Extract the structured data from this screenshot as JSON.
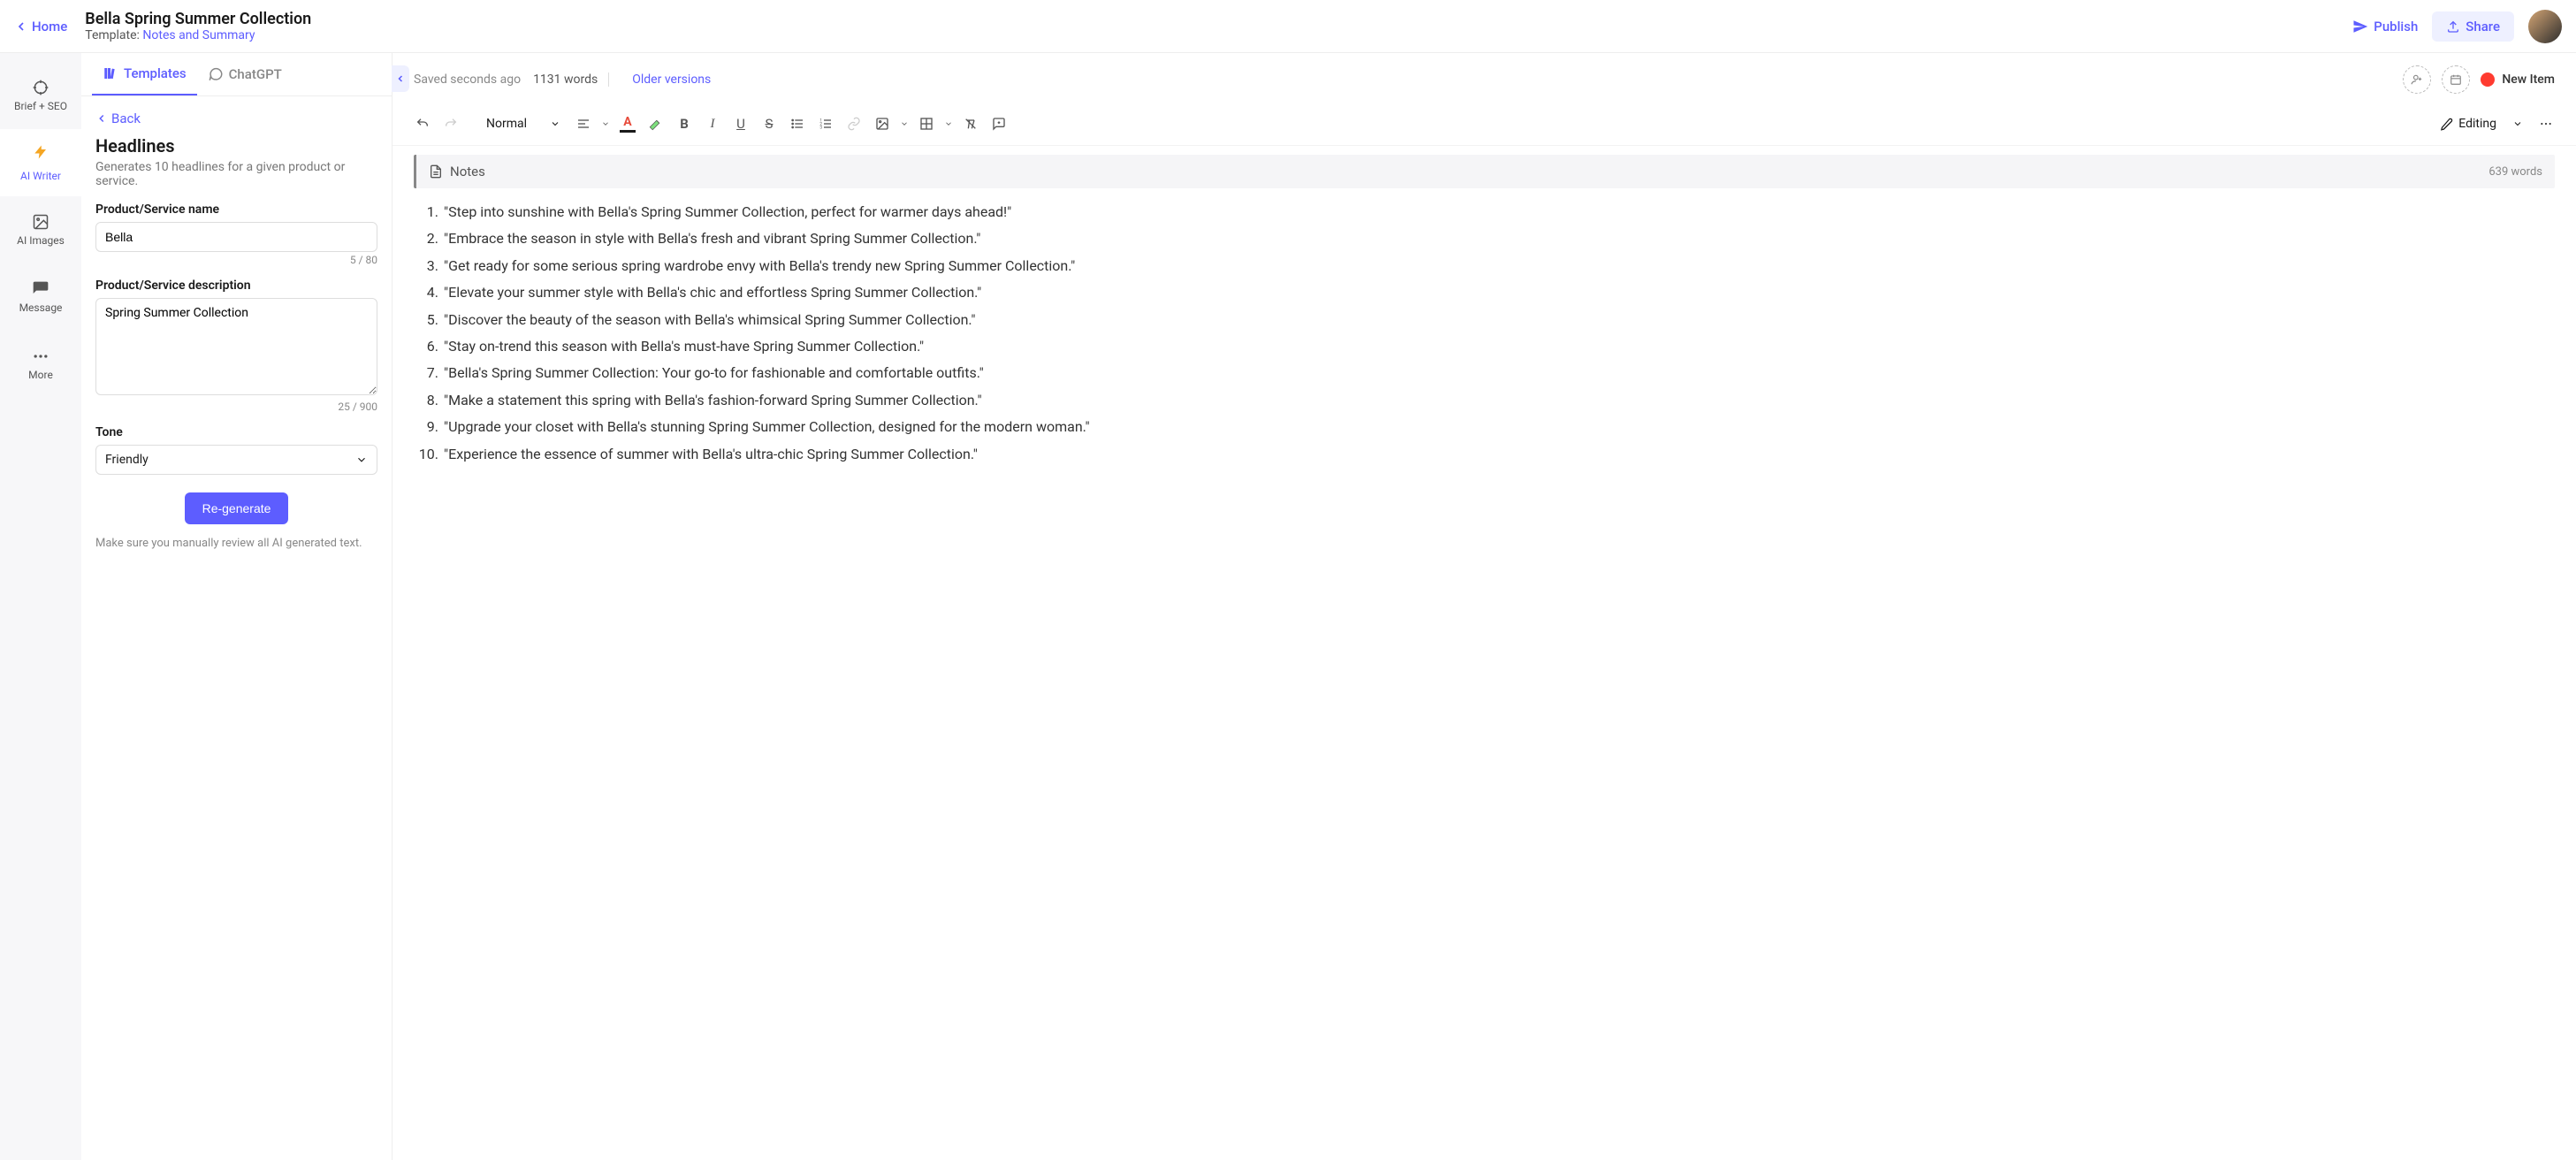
{
  "header": {
    "home": "Home",
    "title": "Bella Spring Summer Collection",
    "template_prefix": "Template: ",
    "template_link": "Notes and Summary",
    "publish": "Publish",
    "share": "Share"
  },
  "leftnav": {
    "brief": "Brief + SEO",
    "writer": "AI Writer",
    "images": "AI Images",
    "message": "Message",
    "more": "More"
  },
  "midpanel": {
    "tab_templates": "Templates",
    "tab_chatgpt": "ChatGPT",
    "back": "Back",
    "section_title": "Headlines",
    "section_desc": "Generates 10 headlines for a given product or service.",
    "name_label": "Product/Service name",
    "name_value": "Bella",
    "name_counter": "5 / 80",
    "desc_label": "Product/Service description",
    "desc_value": "Spring Summer Collection",
    "desc_counter": "25 / 900",
    "tone_label": "Tone",
    "tone_value": "Friendly",
    "regenerate": "Re-generate",
    "review_note": "Make sure you manually review all AI generated text."
  },
  "editor": {
    "saved": "Saved seconds ago",
    "wordcount": "1131 words",
    "older": "Older versions",
    "new_item": "New Item",
    "style": "Normal",
    "editing": "Editing",
    "notes_title": "Notes",
    "notes_words": "639 words"
  },
  "headlines": [
    "\"Step into sunshine with Bella's Spring Summer Collection, perfect for warmer days ahead!\"",
    "\"Embrace the season in style with Bella's fresh and vibrant Spring Summer Collection.\"",
    "\"Get ready for some serious spring wardrobe envy with Bella's trendy new Spring Summer Collection.\"",
    "\"Elevate your summer style with Bella's chic and effortless Spring Summer Collection.\"",
    "\"Discover the beauty of the season with Bella's whimsical Spring Summer Collection.\"",
    "\"Stay on-trend this season with Bella's must-have Spring Summer Collection.\"",
    "\"Bella's Spring Summer Collection: Your go-to for fashionable and comfortable outfits.\"",
    "\"Make a statement this spring with Bella's fashion-forward Spring Summer Collection.\"",
    "\"Upgrade your closet with Bella's stunning Spring Summer Collection, designed for the modern woman.\"",
    "\"Experience the essence of summer with Bella's ultra-chic Spring Summer Collection.\""
  ]
}
